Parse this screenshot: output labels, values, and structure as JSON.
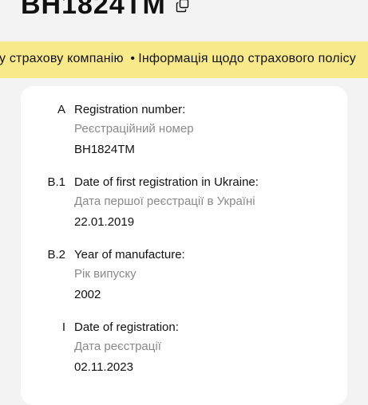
{
  "header": {
    "plate_number": "BH1824TM",
    "copy_icon": "copy-icon"
  },
  "ticker": {
    "items": [
      "у страхову компанію",
      "Інформація щодо страхового полісу"
    ],
    "separator": "•",
    "background": "#f8e98a"
  },
  "fields": [
    {
      "code": "A",
      "title": "Registration number:",
      "subtitle": "Реєстраційний номер",
      "value": "BH1824TM"
    },
    {
      "code": "B.1",
      "title": "Date of first registration in Ukraine:",
      "subtitle": "Дата першої реєстрації в Україні",
      "value": "22.01.2019"
    },
    {
      "code": "B.2",
      "title": "Year of manufacture:",
      "subtitle": "Рік випуску",
      "value": "2002"
    },
    {
      "code": "I",
      "title": "Date of registration:",
      "subtitle": "Дата реєстрації",
      "value": "02.11.2023"
    }
  ]
}
